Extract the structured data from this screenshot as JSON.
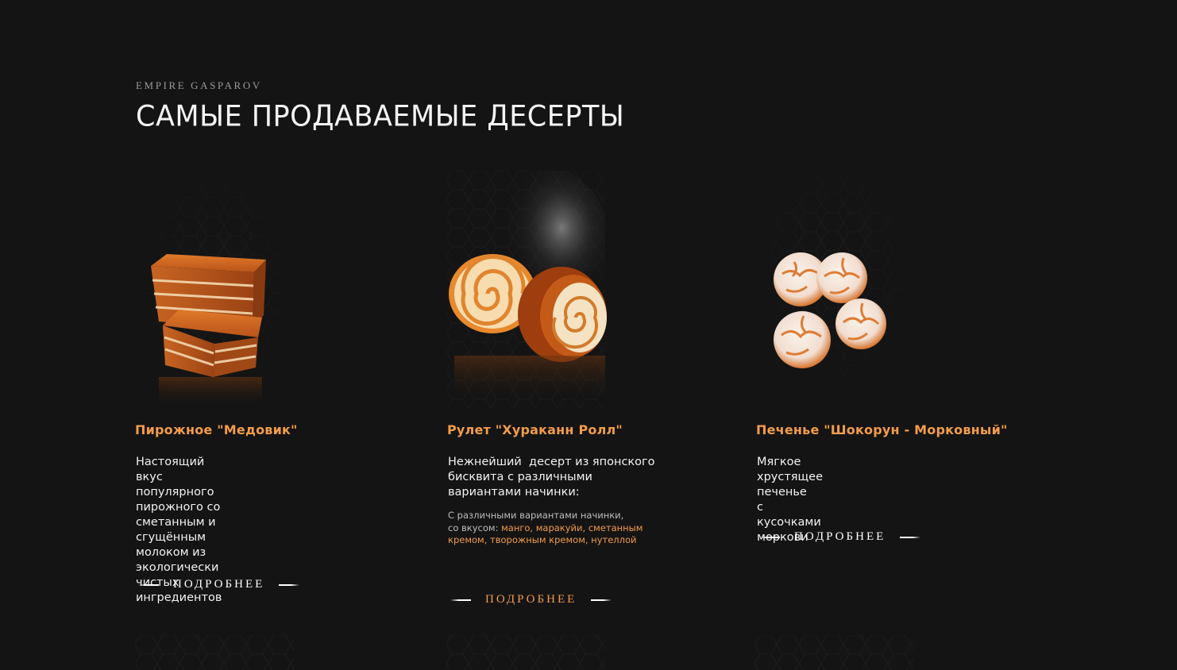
{
  "section": {
    "eyebrow": "EMPIRE GASPAROV",
    "title": "САМЫЕ ПРОДАВАЕМЫЕ ДЕСЕРТЫ"
  },
  "colors": {
    "background": "#141414",
    "accent": "#f29c4c",
    "text": "#f2f2f2"
  },
  "products": [
    {
      "name": "Пирожное \"Медовик\"",
      "description_lines": [
        "Настоящий вкус популярного",
        "пирожного со сметанным и",
        "сгущённым молоком из",
        "экологически чистых",
        "ингредиентов"
      ],
      "image_icon": "honey-cake-image",
      "more_label": "ПОДРОБНЕЕ"
    },
    {
      "name": "Рулет \"Хураканн Ролл\"",
      "description_lines": [
        "Нежнейший  десерт из японского",
        "бисквита с различными",
        "вариантами начинки:"
      ],
      "note_plain_1": "С различными вариантами начинки,",
      "note_plain_2": "со вкусом: ",
      "note_highlight_1": "манго, маракуйи, сметанным",
      "note_highlight_2": "кремом, творожным кремом, нутеллой",
      "image_icon": "roll-cake-image",
      "more_label": "ПОДРОБНЕЕ"
    },
    {
      "name": "Печенье \"Шокорун - Морковный\"",
      "description_lines": [
        "Мягкое хрустящее печенье",
        "с кусочками моркови"
      ],
      "image_icon": "crinkle-cookies-image",
      "more_label": "ПОДРОБНЕЕ"
    }
  ]
}
